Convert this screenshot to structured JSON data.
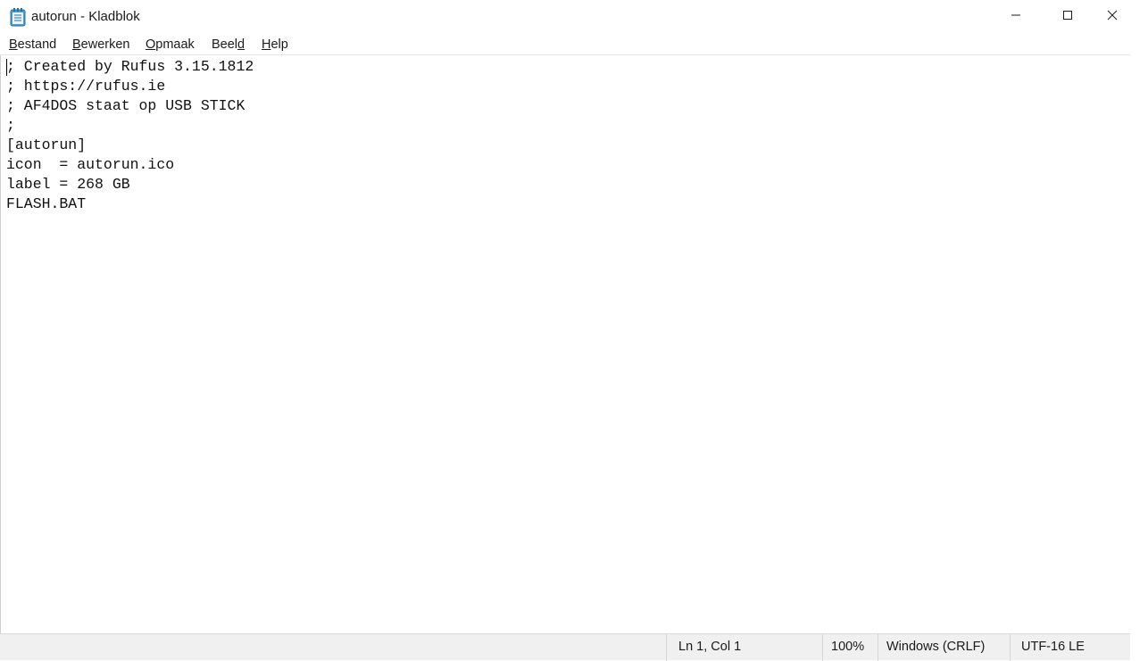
{
  "window": {
    "title": "autorun - Kladblok",
    "app_icon": "notepad-icon",
    "controls": {
      "minimize_icon": "minimize-icon",
      "maximize_icon": "maximize-icon",
      "close_icon": "close-icon"
    }
  },
  "menu": {
    "items": [
      {
        "label": "Bestand",
        "access_key": "B"
      },
      {
        "label": "Bewerken",
        "access_key": "B"
      },
      {
        "label": "Opmaak",
        "access_key": "O"
      },
      {
        "label": "Beeld",
        "access_key": "d"
      },
      {
        "label": "Help",
        "access_key": "H"
      }
    ]
  },
  "editor": {
    "content": "; Created by Rufus 3.15.1812\n; https://rufus.ie\n; AF4DOS staat op USB STICK\n;\n[autorun]\nicon  = autorun.ico\nlabel = 268 GB\nFLASH.BAT"
  },
  "status": {
    "position": "Ln 1, Col 1",
    "zoom": "100%",
    "line_endings": "Windows (CRLF)",
    "encoding": "UTF-16 LE"
  },
  "colors": {
    "background": "#ffffff",
    "statusbar": "#f0f0f0",
    "text": "#111111"
  }
}
